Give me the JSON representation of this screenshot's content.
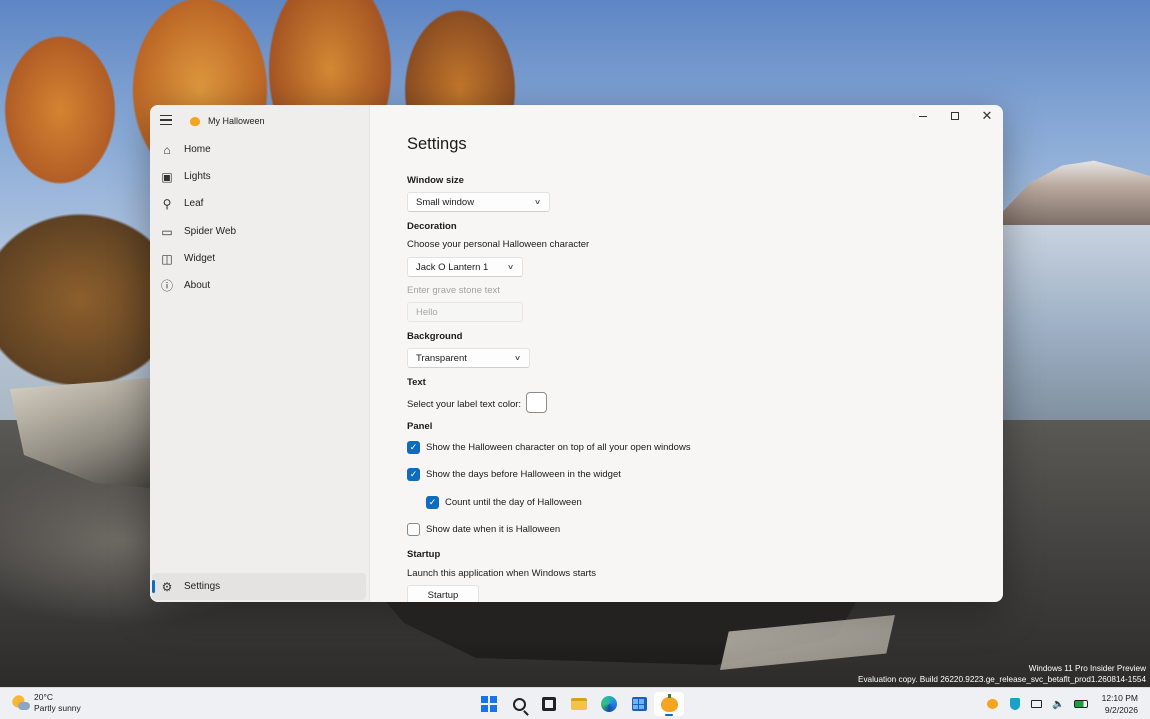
{
  "window": {
    "app_title": "My Halloween"
  },
  "nav": {
    "items": [
      {
        "label": "Home",
        "icon": "home-icon"
      },
      {
        "label": "Lights",
        "icon": "lights-icon"
      },
      {
        "label": "Leaf",
        "icon": "leaf-icon"
      },
      {
        "label": "Spider Web",
        "icon": "spider-web-icon"
      },
      {
        "label": "Widget",
        "icon": "widget-icon"
      },
      {
        "label": "About",
        "icon": "help-icon"
      }
    ],
    "settings_label": "Settings"
  },
  "settings": {
    "page_title": "Settings",
    "window_size": {
      "title": "Window size",
      "selected": "Small window"
    },
    "decoration": {
      "title": "Decoration",
      "character_label": "Choose your personal Halloween character",
      "character_selected": "Jack O Lantern 1",
      "grave_label": "Enter grave stone text",
      "grave_value": "Hello"
    },
    "background": {
      "title": "Background",
      "selected": "Transparent"
    },
    "text": {
      "title": "Text",
      "color_label": "Select your label text color:",
      "color_value": "#ffffff"
    },
    "panel": {
      "title": "Panel",
      "options": [
        {
          "label": "Show the Halloween character on top of all your open windows",
          "checked": true
        },
        {
          "label": "Show the days before Halloween in the widget",
          "checked": true
        },
        {
          "label": "Count until the day of Halloween",
          "checked": true
        },
        {
          "label": "Show date when it is Halloween",
          "checked": false
        }
      ]
    },
    "startup": {
      "title": "Startup",
      "label": "Launch this application when Windows starts",
      "button": "Startup"
    }
  },
  "watermark": {
    "line1": "Windows 11 Pro Insider Preview",
    "line2": "Evaluation copy. Build 26220.9223.ge_release_svc_betaflt_prod1.260814-1554"
  },
  "taskbar": {
    "weather_temp": "20°C",
    "weather_desc": "Partly sunny",
    "time": "12:10 PM",
    "date": "9/2/2026"
  },
  "colors": {
    "accent": "#0f6cbd",
    "pumpkin": "#f4a41f"
  }
}
